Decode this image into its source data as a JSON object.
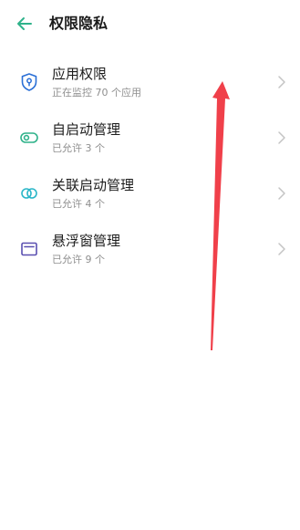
{
  "header": {
    "title": "权限隐私"
  },
  "items": [
    {
      "label": "应用权限",
      "sub": "正在监控 70 个应用",
      "icon": "shield-lock-icon",
      "color": "#2a6fd6"
    },
    {
      "label": "自启动管理",
      "sub": "已允许 3 个",
      "icon": "toggle-icon",
      "color": "#2fb28a"
    },
    {
      "label": "关联启动管理",
      "sub": "已允许 4 个",
      "icon": "link-loop-icon",
      "color": "#2ab6c8"
    },
    {
      "label": "悬浮窗管理",
      "sub": "已允许 9 个",
      "icon": "floating-window-icon",
      "color": "#5a4fb0"
    }
  ],
  "colors": {
    "accent": "#2fb28a",
    "annotation_arrow": "#f0404a"
  }
}
